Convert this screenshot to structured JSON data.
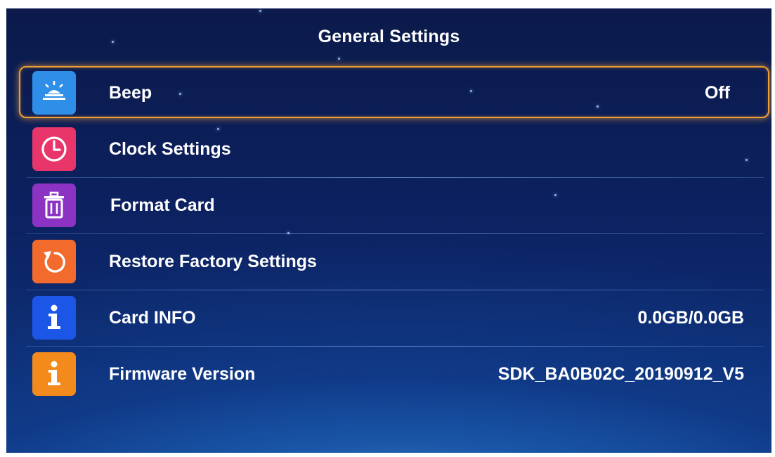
{
  "header": {
    "title": "General Settings"
  },
  "rows": [
    {
      "label": "Beep",
      "value": "Off",
      "icon": "beep-icon",
      "color": "#2f8ee8"
    },
    {
      "label": "Clock Settings",
      "value": "",
      "icon": "clock-icon",
      "color": "#e8356a"
    },
    {
      "label": "Format Card",
      "value": "",
      "icon": "trash-icon",
      "color": "#8c33c4"
    },
    {
      "label": "Restore Factory Settings",
      "value": "",
      "icon": "restore-icon",
      "color": "#f26a2c"
    },
    {
      "label": "Card INFO",
      "value": "0.0GB/0.0GB",
      "icon": "info-icon",
      "color": "#1b56e6"
    },
    {
      "label": "Firmware Version",
      "value": "SDK_BA0B02C_20190912_V5",
      "icon": "info-icon",
      "color": "#f28a1c"
    }
  ],
  "selected_row": "Beep",
  "colors": {
    "highlight": "#f0a030",
    "background": "#0c2160"
  }
}
